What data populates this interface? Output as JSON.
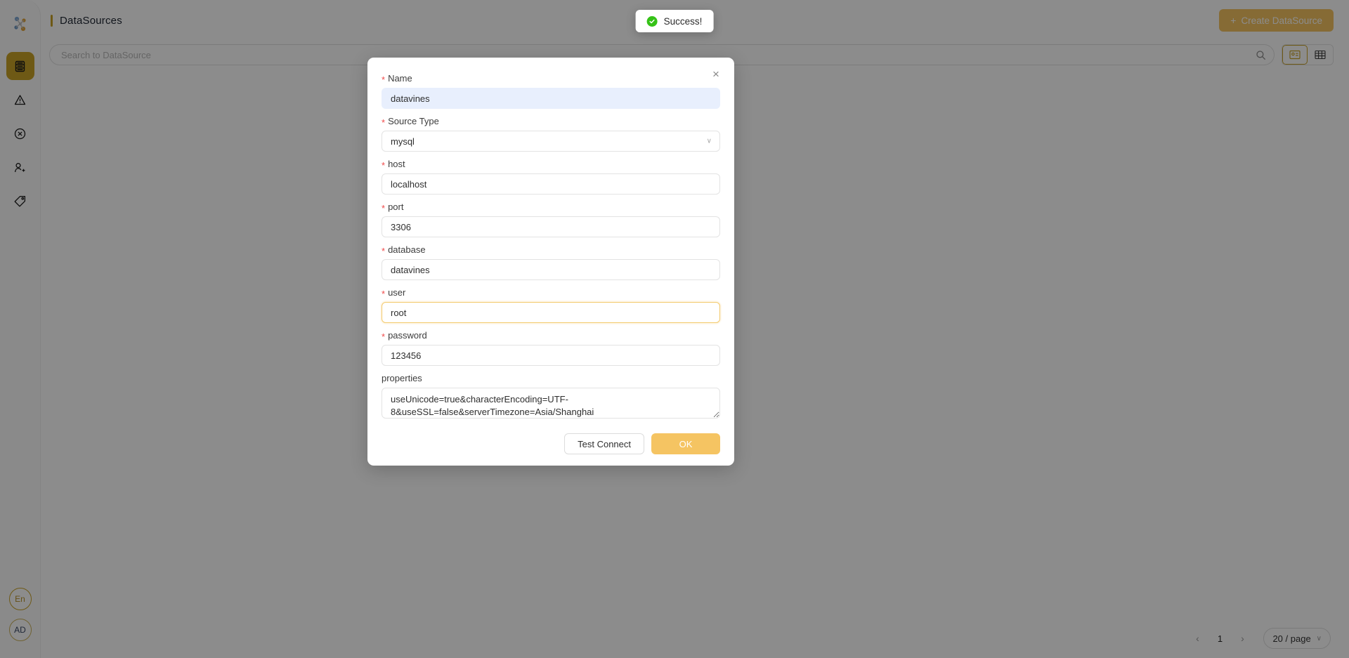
{
  "sidebar": {
    "logo_name": "datavines-logo",
    "items": [
      {
        "icon": "database-icon",
        "name": "sidebar-item-datasources",
        "active": true
      },
      {
        "icon": "warning-triangle-icon",
        "name": "sidebar-item-warnings",
        "active": false
      },
      {
        "icon": "circle-x-icon",
        "name": "sidebar-item-errors",
        "active": false
      },
      {
        "icon": "add-user-icon",
        "name": "sidebar-item-users",
        "active": false
      },
      {
        "icon": "tag-icon",
        "name": "sidebar-item-tags",
        "active": false
      }
    ],
    "language_badge": "En",
    "user_badge": "AD"
  },
  "header": {
    "title": "DataSources",
    "create_button_label": "Create DataSource",
    "create_button_plus": "+",
    "accent_color": "#c9a227",
    "create_button_color": "#f5c462"
  },
  "toolbar": {
    "search_placeholder": "Search to DataSource",
    "search_value": "",
    "search_icon": "search-icon",
    "view_card_icon": "card-view-icon",
    "view_table_icon": "table-view-icon",
    "active_view": "card"
  },
  "pagination": {
    "prev_label": "‹",
    "next_label": "›",
    "current_page": "1",
    "page_size_label": "20 / page",
    "chevron": "∨"
  },
  "toast": {
    "message": "Success!",
    "icon": "success-check-icon",
    "icon_color": "#35c217"
  },
  "modal": {
    "close_icon": "close-icon",
    "close_glyph": "×",
    "required_star": "*",
    "select_chevron": "∨",
    "fields": [
      {
        "label": "Name",
        "value": "datavines",
        "required": true,
        "type": "text",
        "state": "highlighted"
      },
      {
        "label": "Source Type",
        "value": "mysql",
        "required": true,
        "type": "select",
        "state": "normal"
      },
      {
        "label": "host",
        "value": "localhost",
        "required": true,
        "type": "text",
        "state": "normal"
      },
      {
        "label": "port",
        "value": "3306",
        "required": true,
        "type": "text",
        "state": "normal"
      },
      {
        "label": "database",
        "value": "datavines",
        "required": true,
        "type": "text",
        "state": "normal"
      },
      {
        "label": "user",
        "value": "root",
        "required": true,
        "type": "text",
        "state": "focused"
      },
      {
        "label": "password",
        "value": "123456",
        "required": true,
        "type": "text",
        "state": "normal"
      },
      {
        "label": "properties",
        "value": "useUnicode=true&characterEncoding=UTF-8&useSSL=false&serverTimezone=Asia/Shanghai",
        "required": false,
        "type": "textarea",
        "state": "normal"
      }
    ],
    "test_connect_label": "Test Connect",
    "ok_label": "OK"
  }
}
